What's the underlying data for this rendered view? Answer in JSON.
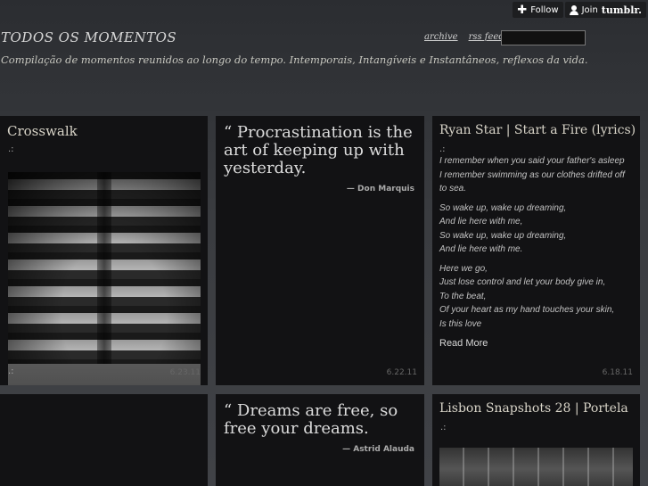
{
  "tumblr_bar": {
    "follow_label": "Follow",
    "join_label": "Join",
    "brand": "tumblr."
  },
  "header": {
    "title": "TODOS OS MOMENTOS",
    "description": "Compilação de momentos reunidos ao longo do tempo. Intemporais, Intangíveis e Instantâneos, reflexos da vida.",
    "nav": {
      "archive": "archive",
      "rss": "rss feed"
    },
    "search_value": ""
  },
  "posts": {
    "crosswalk": {
      "title": "Crosswalk",
      "top_marker": ".:",
      "bottom_marker": ".:",
      "date": "6.23.11"
    },
    "quote1": {
      "text": "“ Procrastination is the art of keeping up with yesterday.",
      "source": "— Don Marquis",
      "date": "6.22.11"
    },
    "ryan": {
      "title": "Ryan Star  |  Start a Fire (lyrics)",
      "marker": ".:",
      "stanza1": [
        "I remember when you said your father's asleep",
        "I remember swimming as our clothes drifted off to sea."
      ],
      "stanza2": [
        "So wake up, wake up dreaming,",
        "And lie here with me,",
        "So wake up, wake up dreaming,",
        "And lie here with me."
      ],
      "stanza3": [
        "Here we go,",
        "Just lose control and let your body give in,",
        "To the beat,",
        "Of your heart as my hand touches your skin,",
        "Is this love"
      ],
      "read_more": "Read More",
      "date": "6.18.11"
    },
    "quote2": {
      "text": "“ Dreams are free, so free your dreams.",
      "source": "— Astrid Alauda"
    },
    "lisbon": {
      "title": "Lisbon Snapshots 28  |  Portela",
      "marker": ".:"
    }
  }
}
